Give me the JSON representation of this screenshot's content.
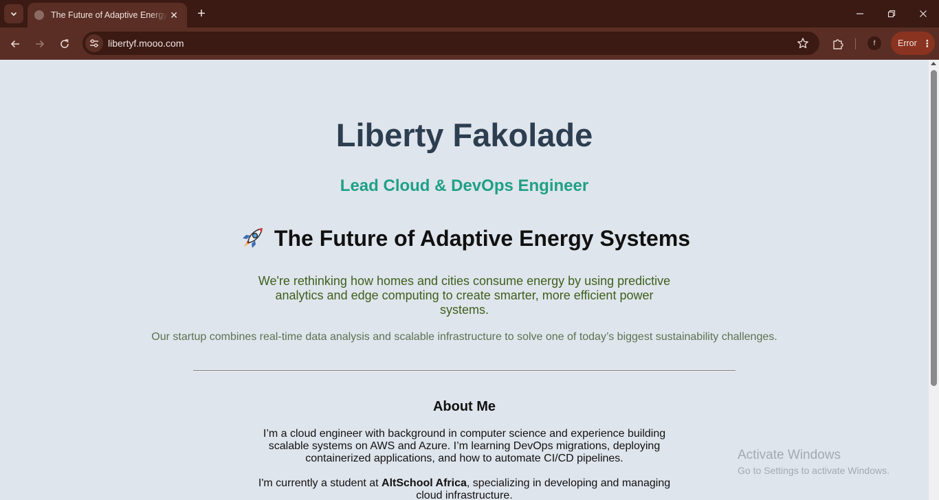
{
  "browser": {
    "tab_title": "The Future of Adaptive Energy Systems",
    "url": "libertyf.mooo.com",
    "profile_initial": "f",
    "error_label": "Error"
  },
  "page": {
    "name": "Liberty Fakolade",
    "role": "Lead Cloud & DevOps Engineer",
    "headline": "The Future of Adaptive Energy Systems",
    "intro": "We're rethinking how homes and cities consume energy by using predictive analytics and edge computing to create smarter, more efficient power systems.",
    "startup": "Our startup combines real-time data analysis and scalable infrastructure to solve one of today’s biggest sustainability challenges.",
    "about": {
      "title": "About Me",
      "p1": "I’m a cloud engineer with background in computer science and experience building scalable systems on AWS and Azure. I’m learning DevOps migrations, deploying containerized applications, and how to automate CI/CD pipelines.",
      "p2_before": "I'm currently a student at ",
      "p2_school": "AltSchool Africa",
      "p2_after": ", specializing in developing and managing cloud infrastructure."
    }
  },
  "watermark": {
    "title": "Activate Windows",
    "subtitle": "Go to Settings to activate Windows."
  },
  "colors": {
    "chrome_dark": "#3a1a13",
    "chrome_mid": "#5a2e24",
    "page_bg": "#dfe5ec",
    "name": "#2c3e50",
    "role": "#1fa087",
    "intro": "#3d5f1c"
  }
}
